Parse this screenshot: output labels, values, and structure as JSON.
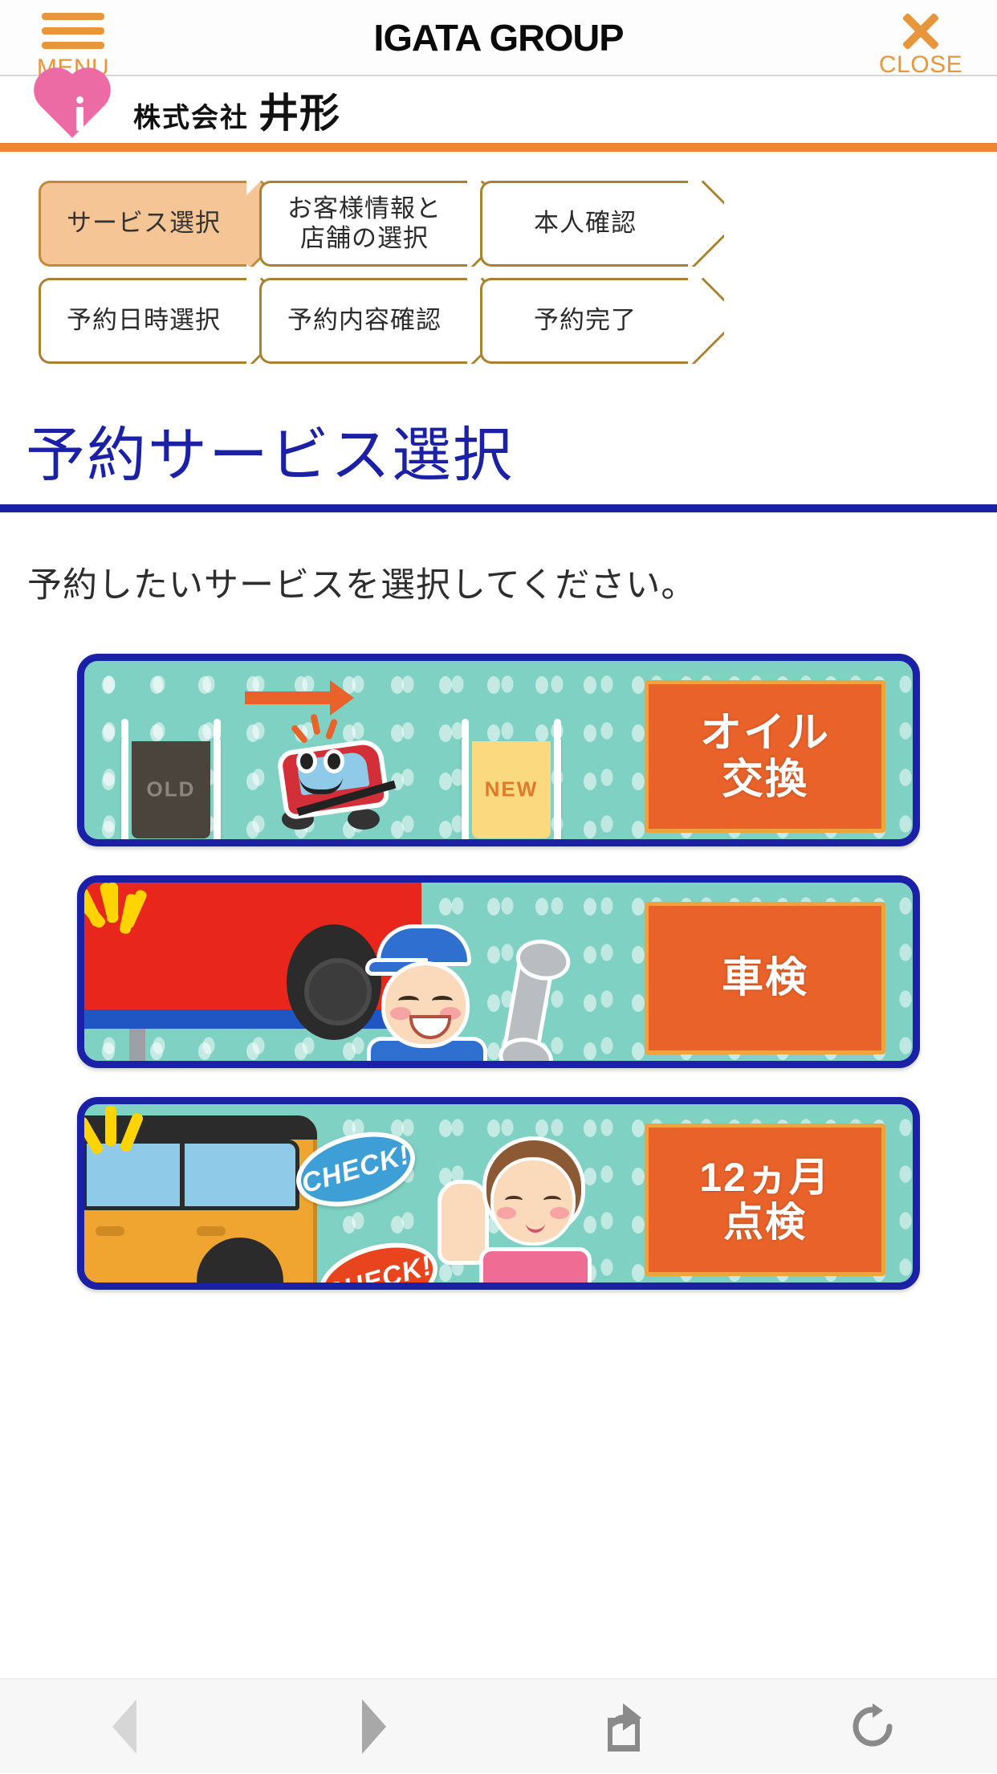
{
  "header": {
    "menu_label": "MENU",
    "brand_title": "IGATA GROUP",
    "close_label": "CLOSE",
    "menu_icon": "hamburger-icon",
    "close_icon": "close-x-icon"
  },
  "logo_bar": {
    "heart_icon": "pink-heart-i-logo",
    "company_prefix": "株式会社",
    "company_name": "井形"
  },
  "steps": {
    "row1": [
      {
        "label": "サービス選択",
        "active": true
      },
      {
        "label": "お客様情報と\n店舗の選択",
        "line1": "お客様情報と",
        "line2": "店舗の選択",
        "active": false
      },
      {
        "label": "本人確認",
        "active": false
      }
    ],
    "row2": [
      {
        "label": "予約日時選択",
        "active": false
      },
      {
        "label": "予約内容確認",
        "active": false
      },
      {
        "label": "予約完了",
        "active": false
      }
    ]
  },
  "page": {
    "title": "予約サービス選択",
    "lead": "予約したいサービスを選択してください。"
  },
  "services": [
    {
      "id": "oil-change",
      "label_line1": "オイル",
      "label_line2": "交換",
      "art": {
        "old_cup_text": "OLD",
        "new_cup_text": "NEW",
        "arrow": "right-arrow",
        "mascot": "red-car-mascot"
      }
    },
    {
      "id": "shaken",
      "label_line1": "車検",
      "label_line2": "",
      "art": {
        "mechanic": "mechanic-with-wrench",
        "car": "red-car-on-lift",
        "tire": "tire"
      }
    },
    {
      "id": "twelve-month-check",
      "label_line1": "12ヵ月",
      "label_line2": "点検",
      "art": {
        "bubble_blue": "CHECK!",
        "bubble_red": "CHECK!",
        "car": "yellow-kei-car",
        "person": "woman-thumbs-up"
      }
    }
  ],
  "bottom_toolbar": {
    "back_icon": "back-triangle-icon",
    "forward_icon": "forward-triangle-icon",
    "share_icon": "share-icon",
    "reload_icon": "reload-icon"
  },
  "colors": {
    "accent_orange": "#e8963c",
    "rule_orange": "#ef8533",
    "title_blue": "#1b21a6",
    "card_teal": "#7fd1c3",
    "label_orange": "#e8622a",
    "heart_pink": "#ec6ba5",
    "step_active": "#f5c595",
    "step_border": "#a9822f"
  }
}
